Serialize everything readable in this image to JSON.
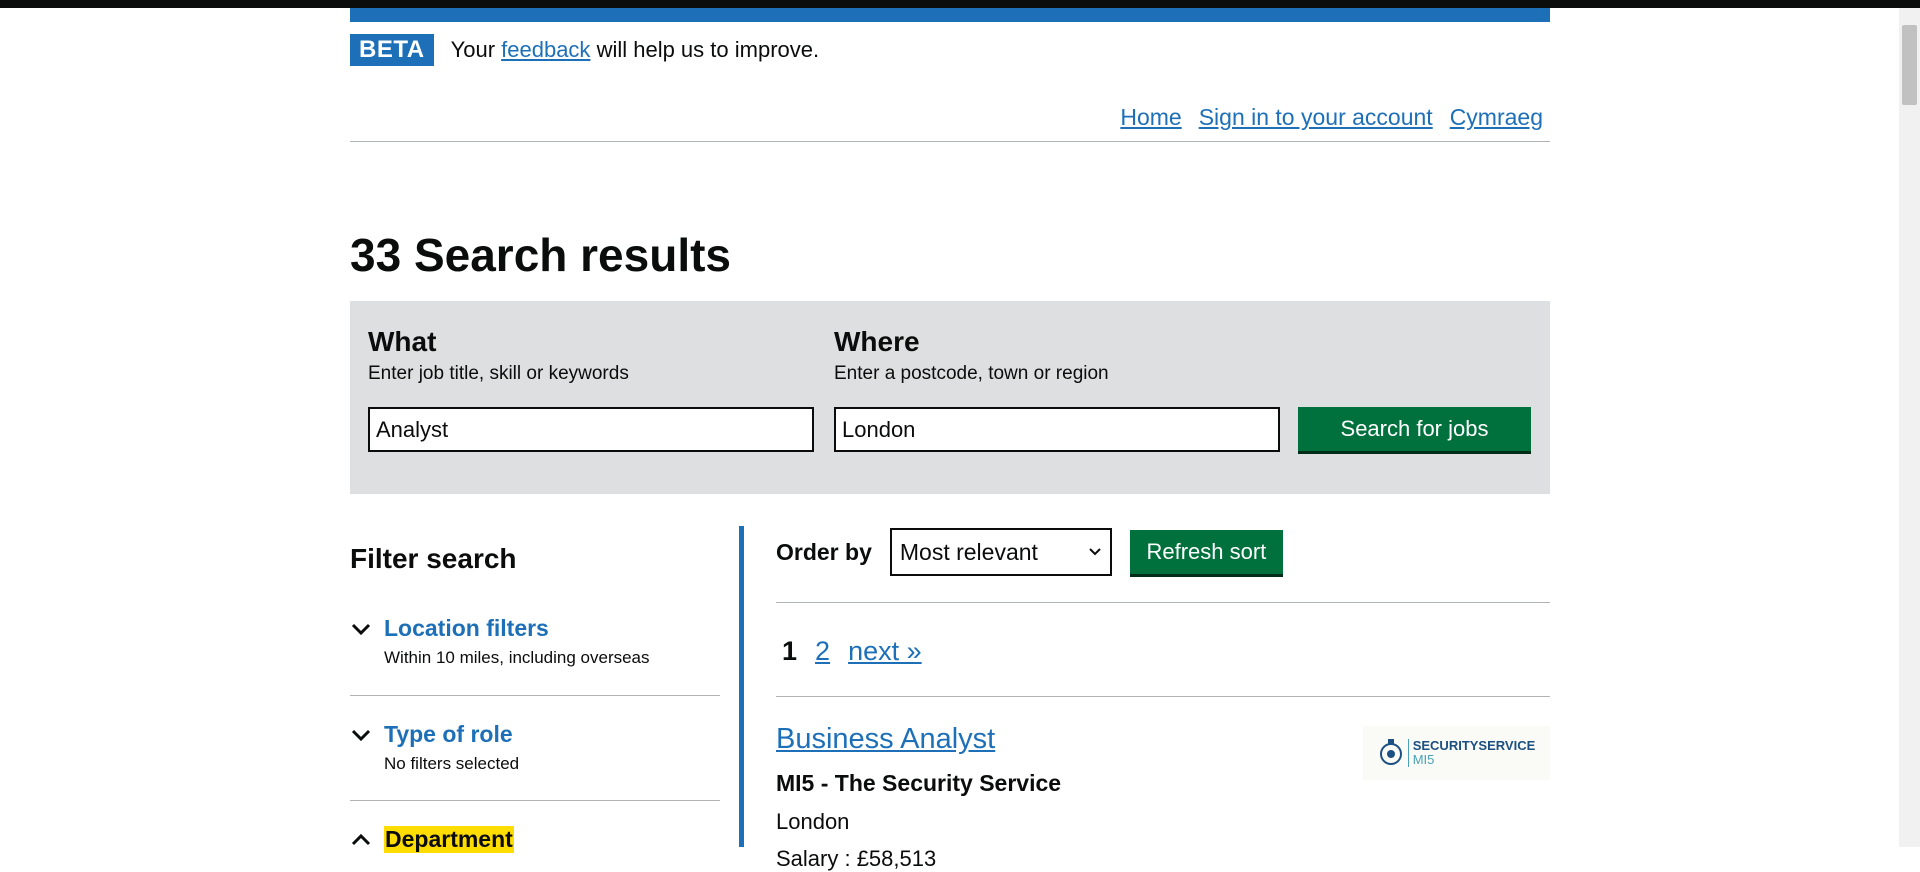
{
  "beta": {
    "tag": "BETA",
    "text_before": "Your",
    "link": "feedback",
    "text_after": "will help us to improve."
  },
  "header": {
    "nav": [
      "Home",
      "Sign in to your account",
      "Cymraeg"
    ]
  },
  "page_title": "33 Search results",
  "search": {
    "what_label": "What",
    "what_hint": "Enter job title, skill or keywords",
    "what_value": "Analyst",
    "where_label": "Where",
    "where_hint": "Enter a postcode, town or region",
    "where_value": "London",
    "button": "Search for jobs"
  },
  "filters": {
    "title": "Filter search",
    "items": [
      {
        "label": "Location filters",
        "summary": "Within 10 miles, including overseas",
        "icon": "chevron-down-icon"
      },
      {
        "label": "Type of role",
        "summary": "No filters selected",
        "icon": "chevron-down-icon"
      },
      {
        "label": "Department",
        "summary": "",
        "icon": "chevron-up-icon"
      }
    ]
  },
  "results": {
    "order_label": "Order by",
    "order_selected": "Most relevant",
    "refresh_button": "Refresh sort",
    "pagination": {
      "current": "1",
      "pages": [
        "2"
      ],
      "next": "next »"
    },
    "jobs": [
      {
        "title": "Business Analyst",
        "department": "MI5 - The Security Service",
        "location": "London",
        "salary": "Salary : £58,513",
        "logo_line1": "SECURITYSERVICE",
        "logo_line2": "MI5"
      }
    ]
  },
  "colors": {
    "link_blue": "#1d70b8",
    "button_green": "#00703c",
    "panel_grey": "#dedfe0",
    "focus_yellow": "#ffdd00"
  }
}
